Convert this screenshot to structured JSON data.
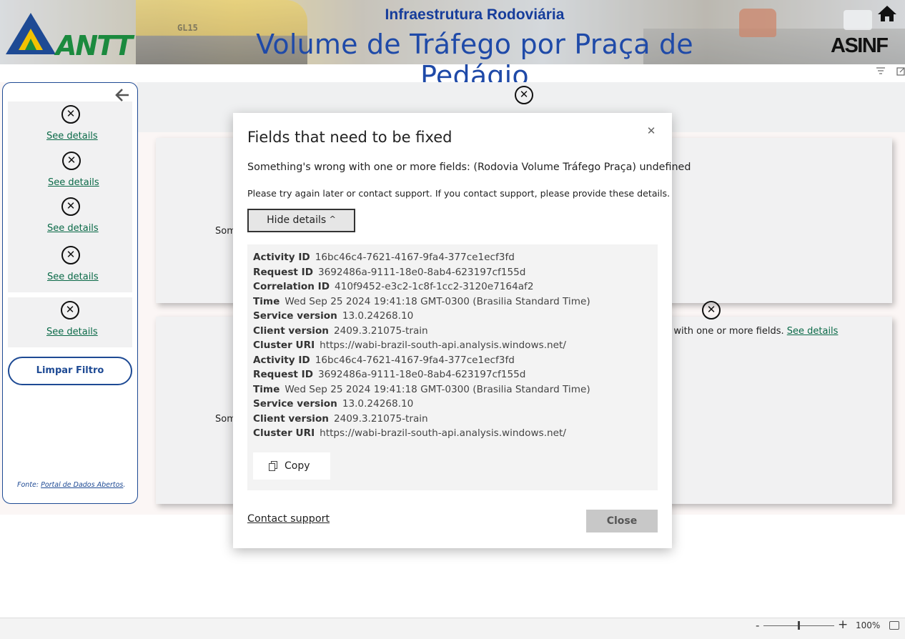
{
  "header": {
    "subtitle": "Infraestrutura Rodoviária",
    "title": "Volume de Tráfego por Praça de Pedágio",
    "logo_left": "ANTT",
    "logo_right": "ASINF",
    "truck_plate": "GL15",
    "home_icon": "home-icon"
  },
  "sidebar": {
    "slicers": [
      {
        "link": "See details"
      },
      {
        "link": "See details"
      },
      {
        "link": "See details"
      },
      {
        "link": "See details"
      },
      {
        "link": "See details"
      }
    ],
    "clear_button": "Limpar Filtro",
    "source_prefix": "Fonte: ",
    "source_link": "Portal de Dados Abertos",
    "source_suffix": "."
  },
  "visuals": {
    "left_truncated_1": "Som",
    "left_truncated_2": "Som",
    "right_error_text": "g with one or more fields. ",
    "right_error_link": "See details"
  },
  "modal": {
    "title": "Fields that need to be fixed",
    "message": "Something's wrong with one or more fields: (Rodovia Volume Tráfego Praça) undefined",
    "message2": "Please try again later or contact support. If you contact support, please provide these details.",
    "hide_details": "Hide details",
    "details": [
      {
        "label": "Activity ID",
        "value": "16bc46c4-7621-4167-9fa4-377ce1ecf3fd"
      },
      {
        "label": "Request ID",
        "value": "3692486a-9111-18e0-8ab4-623197cf155d"
      },
      {
        "label": "Correlation ID",
        "value": "410f9452-e3c2-1c8f-1cc2-3120e7164af2"
      },
      {
        "label": "Time",
        "value": "Wed Sep 25 2024 19:41:18 GMT-0300 (Brasilia Standard Time)"
      },
      {
        "label": "Service version",
        "value": "13.0.24268.10"
      },
      {
        "label": "Client version",
        "value": "2409.3.21075-train"
      },
      {
        "label": "Cluster URI",
        "value": "https://wabi-brazil-south-api.analysis.windows.net/"
      },
      {
        "label": "Activity ID",
        "value": "16bc46c4-7621-4167-9fa4-377ce1ecf3fd"
      },
      {
        "label": "Request ID",
        "value": "3692486a-9111-18e0-8ab4-623197cf155d"
      },
      {
        "label": "Time",
        "value": "Wed Sep 25 2024 19:41:18 GMT-0300 (Brasilia Standard Time)"
      },
      {
        "label": "Service version",
        "value": "13.0.24268.10"
      },
      {
        "label": "Client version",
        "value": "2409.3.21075-train"
      },
      {
        "label": "Cluster URI",
        "value": "https://wabi-brazil-south-api.analysis.windows.net/"
      }
    ],
    "copy": "Copy",
    "contact_support": "Contact support",
    "close": "Close"
  },
  "statusbar": {
    "zoom_minus": "-",
    "zoom_plus": "+",
    "zoom_level": "100%",
    "zoom_fraction": 0.5
  },
  "colors": {
    "brand_blue": "#1e4a94",
    "link_green": "#0b6a48",
    "logo_green": "#1b8a3e",
    "logo_yellow": "#f2c200"
  }
}
